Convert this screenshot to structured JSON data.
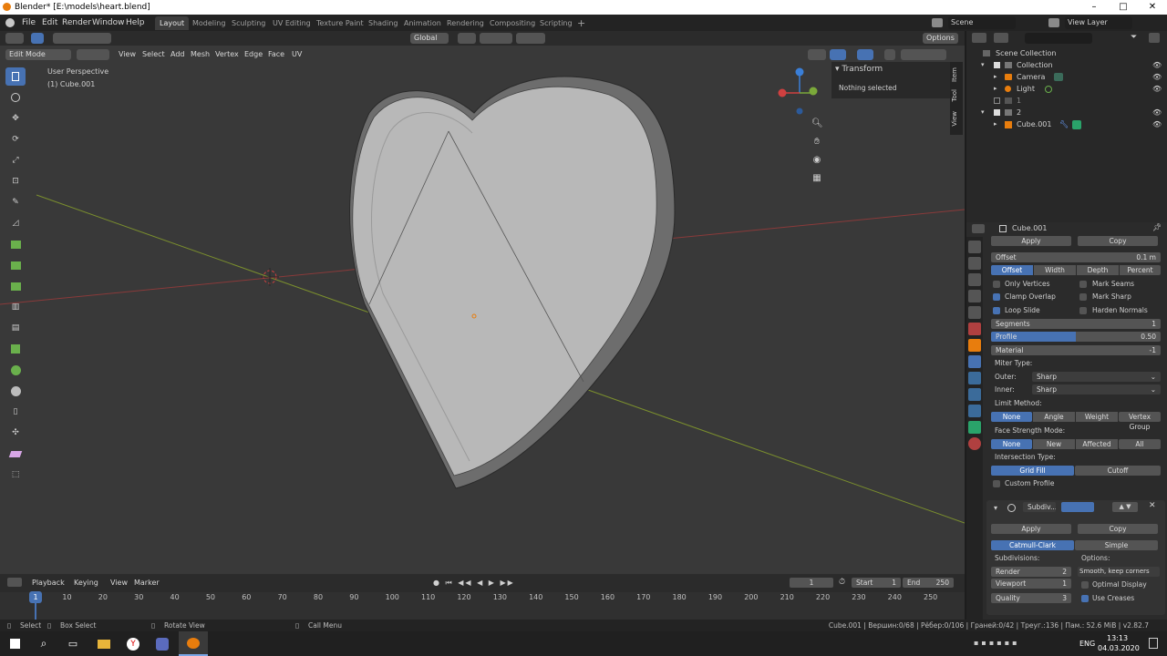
{
  "window": {
    "title": "Blender* [E:\\models\\heart.blend]",
    "min": "–",
    "max": "□",
    "close": "✕"
  },
  "menu": [
    "File",
    "Edit",
    "Render",
    "Window",
    "Help"
  ],
  "workspaces": [
    "Layout",
    "Modeling",
    "Sculpting",
    "UV Editing",
    "Texture Paint",
    "Shading",
    "Animation",
    "Rendering",
    "Compositing",
    "Scripting"
  ],
  "scene": "Scene",
  "view_layer": "View Layer",
  "viewport": {
    "mode": "Edit Mode",
    "menus": [
      "View",
      "Select",
      "Add",
      "Mesh",
      "Vertex",
      "Edge",
      "Face",
      "UV"
    ],
    "orientation": "Global",
    "options": "Options",
    "perspective": "User Perspective",
    "object": "(1) Cube.001",
    "transform_title": "Transform",
    "nothing_selected": "Nothing selected",
    "side_tabs": [
      "Item",
      "Tool",
      "View"
    ]
  },
  "outliner": {
    "search_placeholder": "",
    "rows": [
      {
        "label": "Scene Collection"
      },
      {
        "label": "Collection"
      },
      {
        "label": "Camera"
      },
      {
        "label": "Light"
      },
      {
        "label": "1"
      },
      {
        "label": "2"
      },
      {
        "label": "Cube.001"
      }
    ]
  },
  "properties": {
    "object": "Cube.001",
    "bevel": {
      "apply": "Apply",
      "copy": "Copy",
      "offset_label": "Offset",
      "offset_value": "0.1 m",
      "width_type": [
        "Offset",
        "Width",
        "Depth",
        "Percent"
      ],
      "only_vertices": "Only Vertices",
      "mark_seams": "Mark Seams",
      "clamp_overlap": "Clamp Overlap",
      "mark_sharp": "Mark Sharp",
      "loop_slide": "Loop Slide",
      "harden_normals": "Harden Normals",
      "segments_label": "Segments",
      "segments_value": "1",
      "profile_label": "Profile",
      "profile_value": "0.50",
      "profile_fraction": 0.5,
      "material_label": "Material",
      "material_value": "-1",
      "miter_type": "Miter Type:",
      "outer_label": "Outer:",
      "outer_value": "Sharp",
      "inner_label": "Inner:",
      "inner_value": "Sharp",
      "limit_method": "Limit Method:",
      "limit_options": [
        "None",
        "Angle",
        "Weight",
        "Vertex Group"
      ],
      "face_strength": "Face Strength Mode:",
      "face_options": [
        "None",
        "New",
        "Affected",
        "All"
      ],
      "intersection": "Intersection Type:",
      "intersection_options": [
        "Grid Fill",
        "Cutoff"
      ],
      "custom_profile": "Custom Profile"
    },
    "subdiv": {
      "name": "Subdiv...",
      "apply": "Apply",
      "copy": "Copy",
      "types": [
        "Catmull-Clark",
        "Simple"
      ],
      "subdivisions": "Subdivisions:",
      "options": "Options:",
      "render_label": "Render",
      "render_value": "2",
      "viewport_label": "Viewport",
      "viewport_value": "1",
      "quality_label": "Quality",
      "quality_value": "3",
      "smooth": "Smooth, keep corners",
      "optimal_display": "Optimal Display",
      "use_creases": "Use Creases"
    }
  },
  "timeline": {
    "menus": [
      "Playback",
      "Keying",
      "View",
      "Marker"
    ],
    "current": "1",
    "start_label": "Start",
    "start": "1",
    "end_label": "End",
    "end": "250",
    "ticks": [
      "1",
      "10",
      "20",
      "30",
      "40",
      "50",
      "60",
      "70",
      "80",
      "90",
      "100",
      "110",
      "120",
      "130",
      "140",
      "150",
      "160",
      "170",
      "180",
      "190",
      "200",
      "210",
      "220",
      "230",
      "240",
      "250"
    ]
  },
  "status": {
    "select": "Select",
    "box_select": "Box Select",
    "rotate_view": "Rotate View",
    "call_menu": "Call Menu",
    "stats": "Cube.001 | Вершин:0/68 | Рёбер:0/106 | Граней:0/42 | Треуг.:136 | Пам.: 52.6 MiB | v2.82.7"
  },
  "taskbar": {
    "lang": "ENG",
    "time": "13:13",
    "date": "04.03.2020"
  }
}
